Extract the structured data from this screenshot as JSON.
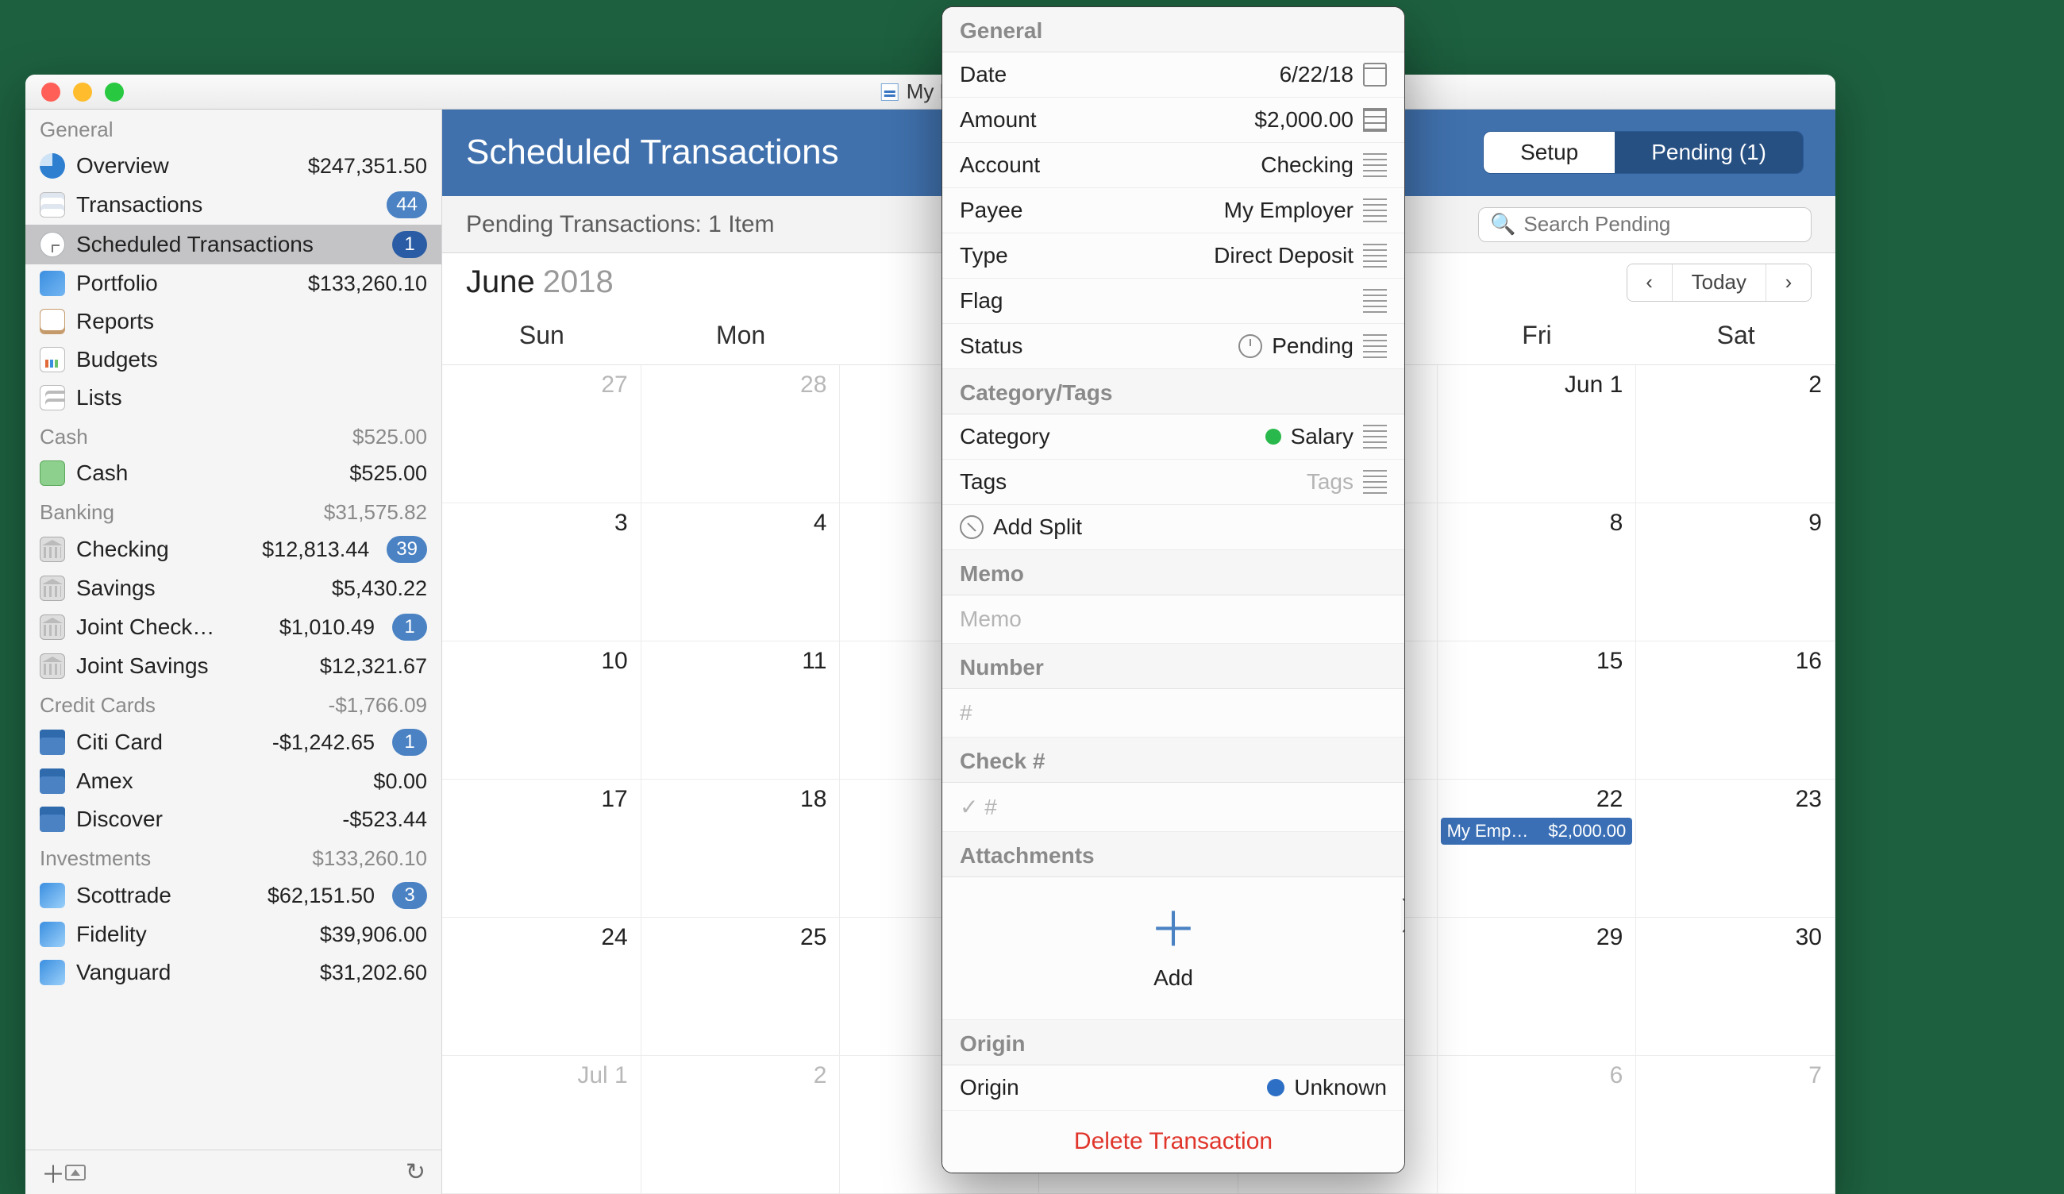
{
  "window_title": "My Fina",
  "sidebar": {
    "sections": [
      {
        "title": "General",
        "total": "",
        "items": [
          {
            "icon": "overview",
            "label": "Overview",
            "val": "$247,351.50"
          },
          {
            "icon": "txn",
            "label": "Transactions",
            "badge": "44"
          },
          {
            "icon": "sched",
            "label": "Scheduled Transactions",
            "badge": "1",
            "active": true
          },
          {
            "icon": "port",
            "label": "Portfolio",
            "val": "$133,260.10"
          },
          {
            "icon": "report",
            "label": "Reports"
          },
          {
            "icon": "budget",
            "label": "Budgets"
          },
          {
            "icon": "list",
            "label": "Lists"
          }
        ]
      },
      {
        "title": "Cash",
        "total": "$525.00",
        "items": [
          {
            "icon": "cash",
            "label": "Cash",
            "val": "$525.00"
          }
        ]
      },
      {
        "title": "Banking",
        "total": "$31,575.82",
        "items": [
          {
            "icon": "bank",
            "label": "Checking",
            "val": "$12,813.44",
            "badge": "39"
          },
          {
            "icon": "bank",
            "label": "Savings",
            "val": "$5,430.22"
          },
          {
            "icon": "bank",
            "label": "Joint Check…",
            "val": "$1,010.49",
            "badge": "1"
          },
          {
            "icon": "bank",
            "label": "Joint Savings",
            "val": "$12,321.67"
          }
        ]
      },
      {
        "title": "Credit Cards",
        "total": "-$1,766.09",
        "items": [
          {
            "icon": "card",
            "label": "Citi Card",
            "val": "-$1,242.65",
            "badge": "1"
          },
          {
            "icon": "card",
            "label": "Amex",
            "val": "$0.00"
          },
          {
            "icon": "card",
            "label": "Discover",
            "val": "-$523.44"
          }
        ]
      },
      {
        "title": "Investments",
        "total": "$133,260.10",
        "items": [
          {
            "icon": "inv",
            "label": "Scottrade",
            "val": "$62,151.50",
            "badge": "3"
          },
          {
            "icon": "inv",
            "label": "Fidelity",
            "val": "$39,906.00"
          },
          {
            "icon": "inv",
            "label": "Vanguard",
            "val": "$31,202.60"
          }
        ]
      }
    ]
  },
  "main": {
    "title": "Scheduled Transactions",
    "seg_setup": "Setup",
    "seg_pending": "Pending (1)",
    "subtitle": "Pending Transactions: 1 Item",
    "search_placeholder": "Search Pending",
    "month": "June",
    "year": "2018",
    "today_label": "Today",
    "days": [
      "Sun",
      "Mon",
      "",
      "",
      "",
      "Fri",
      "Sat"
    ],
    "weeks": [
      [
        {
          "n": "27",
          "fade": true
        },
        {
          "n": "28",
          "fade": true
        },
        {
          "n": ""
        },
        {
          "n": ""
        },
        {
          "n": ""
        },
        {
          "n": "Jun 1"
        },
        {
          "n": "2"
        }
      ],
      [
        {
          "n": "3"
        },
        {
          "n": "4"
        },
        {
          "n": ""
        },
        {
          "n": ""
        },
        {
          "n": ""
        },
        {
          "n": "8"
        },
        {
          "n": "9"
        }
      ],
      [
        {
          "n": "10"
        },
        {
          "n": "11"
        },
        {
          "n": ""
        },
        {
          "n": ""
        },
        {
          "n": ""
        },
        {
          "n": "15"
        },
        {
          "n": "16"
        }
      ],
      [
        {
          "n": "17"
        },
        {
          "n": "18"
        },
        {
          "n": ""
        },
        {
          "n": ""
        },
        {
          "n": ""
        },
        {
          "n": "22",
          "event": {
            "l": "My Emp…",
            "r": "$2,000.00"
          }
        },
        {
          "n": "23"
        }
      ],
      [
        {
          "n": "24"
        },
        {
          "n": "25"
        },
        {
          "n": ""
        },
        {
          "n": ""
        },
        {
          "n": ""
        },
        {
          "n": "29"
        },
        {
          "n": "30"
        }
      ],
      [
        {
          "n": "Jul 1",
          "fade": true
        },
        {
          "n": "2",
          "fade": true
        },
        {
          "n": ""
        },
        {
          "n": ""
        },
        {
          "n": ""
        },
        {
          "n": "6",
          "fade": true
        },
        {
          "n": "7",
          "fade": true
        }
      ]
    ]
  },
  "popover": {
    "sec_general": "General",
    "date_k": "Date",
    "date_v": "6/22/18",
    "amount_k": "Amount",
    "amount_v": "$2,000.00",
    "account_k": "Account",
    "account_v": "Checking",
    "payee_k": "Payee",
    "payee_v": "My Employer",
    "type_k": "Type",
    "type_v": "Direct Deposit",
    "flag_k": "Flag",
    "flag_v": "",
    "status_k": "Status",
    "status_v": "Pending",
    "sec_cat": "Category/Tags",
    "cat_k": "Category",
    "cat_v": "Salary",
    "tags_k": "Tags",
    "tags_ph": "Tags",
    "addsplit": "Add Split",
    "sec_memo": "Memo",
    "memo_ph": "Memo",
    "sec_num": "Number",
    "num_ph": "#",
    "sec_check": "Check #",
    "check_ph": "✓ #",
    "sec_att": "Attachments",
    "att_add": "Add",
    "sec_origin": "Origin",
    "origin_k": "Origin",
    "origin_v": "Unknown",
    "delete": "Delete Transaction"
  }
}
